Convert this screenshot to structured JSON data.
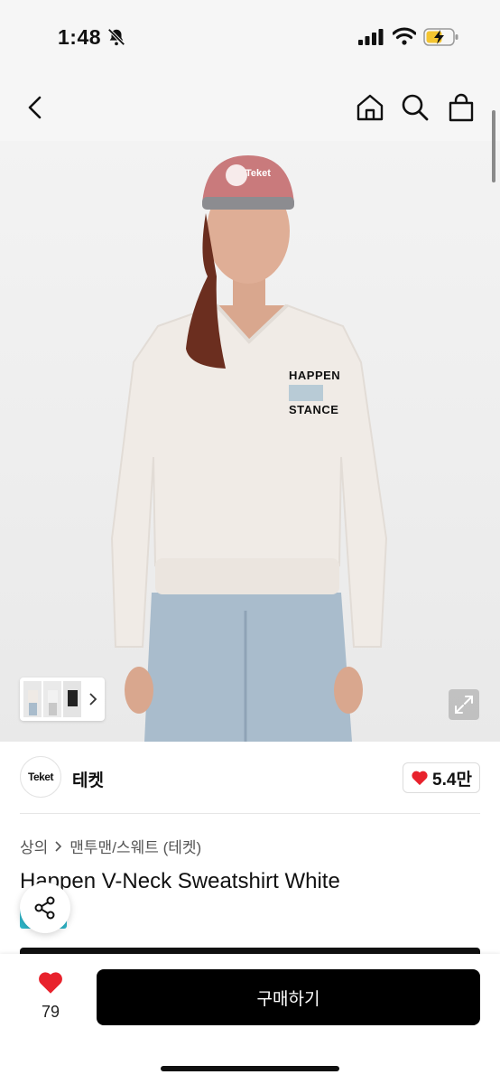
{
  "status_bar": {
    "time": "1:48"
  },
  "nav": {
    "icons": [
      "back-icon",
      "home-icon",
      "search-icon",
      "bag-icon"
    ]
  },
  "product": {
    "brand_logo_text": "Teket",
    "brand_name": "테켓",
    "brand_likes": "5.4만",
    "breadcrumb": [
      "상의",
      "맨투맨/스웨트 (테켓)"
    ],
    "title": "Happen V-Neck Sweatshirt White",
    "image_print_lines": [
      "HAPPEN",
      "STANCE"
    ],
    "cap_text": "Teket"
  },
  "bottom_bar": {
    "like_count": "79",
    "buy_label": "구매하기"
  },
  "colors": {
    "accent": "#000000",
    "heart": "#e8222c",
    "chip": "#2fb6c9"
  }
}
